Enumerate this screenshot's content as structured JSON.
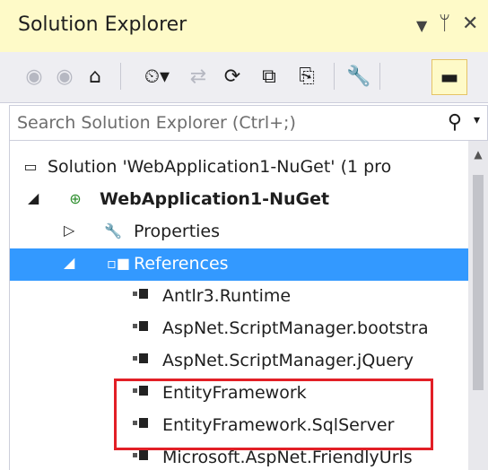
{
  "panel": {
    "title": "Solution Explorer",
    "controls": [
      "▼",
      "ᛘ",
      "✕"
    ]
  },
  "toolbar": {
    "buttons": [
      {
        "icon": "back-icon",
        "glyph": "◉"
      },
      {
        "icon": "forward-icon",
        "glyph": "◉"
      },
      {
        "icon": "home-icon",
        "glyph": "⌂"
      },
      {
        "icon": "pending-changes-icon",
        "glyph": "⏲▾"
      },
      {
        "icon": "sync-icon",
        "glyph": "⇄"
      },
      {
        "icon": "refresh-icon",
        "glyph": "⟳"
      },
      {
        "icon": "collapse-all-icon",
        "glyph": "⧉"
      },
      {
        "icon": "show-all-files-icon",
        "glyph": "⎘"
      },
      {
        "icon": "properties-icon",
        "glyph": "🔧"
      },
      {
        "icon": "preview-icon",
        "glyph": "▬"
      }
    ]
  },
  "search": {
    "placeholder": "Search Solution Explorer (Ctrl+;)",
    "icon": "search-icon",
    "dropdown": "▾"
  },
  "tree": {
    "solution": {
      "label": "Solution 'WebApplication1-NuGet' (1 pro",
      "icon": "solution-icon"
    },
    "project": {
      "label": "WebApplication1-NuGet",
      "expander": "◢",
      "icon": "web-project-icon"
    },
    "properties": {
      "label": "Properties",
      "expander": "▷",
      "icon": "wrench-icon"
    },
    "references": {
      "label": "References",
      "expander": "◢",
      "icon": "references-icon"
    },
    "reference_items": [
      "Antlr3.Runtime",
      "AspNet.ScriptManager.bootstra",
      "AspNet.ScriptManager.jQuery",
      "EntityFramework",
      "EntityFramework.SqlServer",
      "Microsoft.AspNet.FriendlyUrls"
    ]
  },
  "colors": {
    "title_bg": "#fefac8",
    "selection": "#3399ff",
    "highlight_border": "#e21f26"
  }
}
